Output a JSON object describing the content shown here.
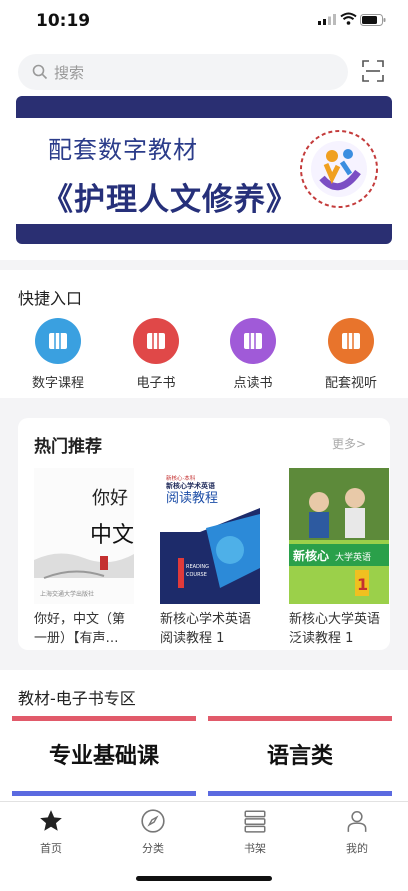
{
  "status": {
    "time": "10:19"
  },
  "search": {
    "placeholder": "搜索"
  },
  "banner": {
    "line1": "配套数字教材",
    "line2": "《护理人文修养》"
  },
  "quick": {
    "title": "快捷入口",
    "items": [
      {
        "label": "数字课程",
        "color": "#3aa0e0",
        "icon": "book-icon"
      },
      {
        "label": "电子书",
        "color": "#e04848",
        "icon": "book-icon"
      },
      {
        "label": "点读书",
        "color": "#a05ad8",
        "icon": "book-icon"
      },
      {
        "label": "配套视听",
        "color": "#e8742c",
        "icon": "book-icon"
      }
    ]
  },
  "hot": {
    "title": "热门推荐",
    "more": "更多>",
    "books": [
      {
        "line1": "你好，中文（第",
        "line2": "一册）【有声…",
        "cover_text": "你好，中文"
      },
      {
        "line1": "新核心学术英语",
        "line2": "阅读教程 1",
        "cover_text": "阅读教程",
        "cover_series": "新核心学术英语"
      },
      {
        "line1": "新核心大学英语",
        "line2": "泛读教程 1",
        "cover_text": "新核心大学英语"
      }
    ]
  },
  "zone": {
    "title": "教材-电子书专区",
    "cats": [
      {
        "label": "专业基础课"
      },
      {
        "label": "语言类"
      }
    ]
  },
  "tabs": [
    {
      "label": "首页",
      "icon": "star-icon"
    },
    {
      "label": "分类",
      "icon": "compass-icon"
    },
    {
      "label": "书架",
      "icon": "bookshelf-icon"
    },
    {
      "label": "我的",
      "icon": "user-icon"
    }
  ]
}
